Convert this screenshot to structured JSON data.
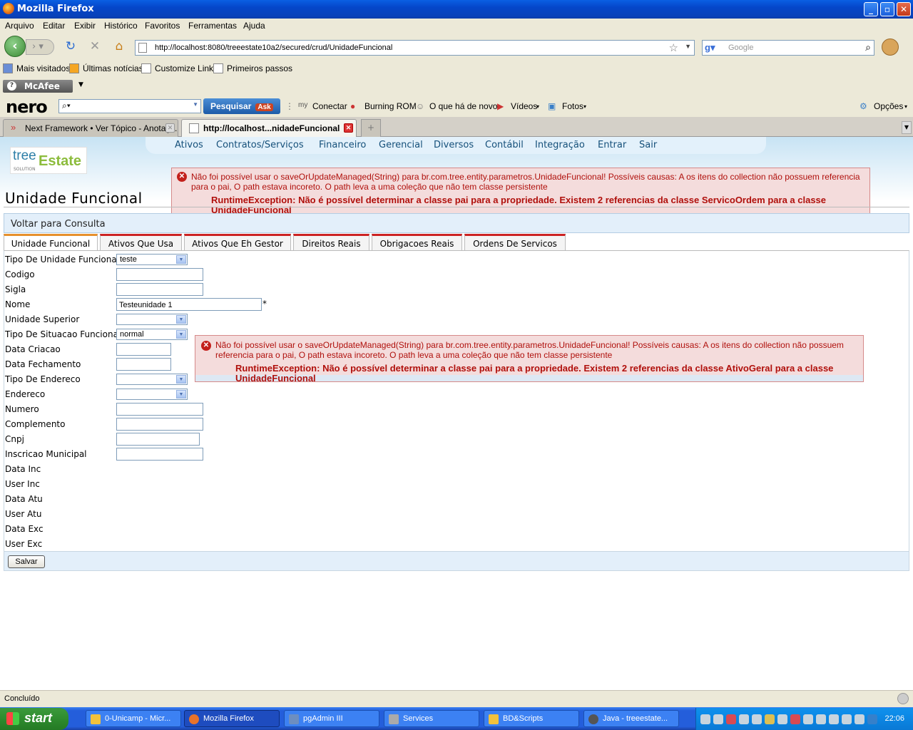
{
  "window": {
    "title": "Mozilla Firefox"
  },
  "menubar": [
    "Arquivo",
    "Editar",
    "Exibir",
    "Histórico",
    "Favoritos",
    "Ferramentas",
    "Ajuda"
  ],
  "nav": {
    "url": "http://localhost:8080/treeestate10a2/secured/crud/UnidadeFuncional",
    "search_placeholder": "Google"
  },
  "bookmarks": [
    "Mais visitados",
    "Últimas notícias",
    "Customize Links",
    "Primeiros passos"
  ],
  "mcafee": {
    "label": "McAfee"
  },
  "nero": {
    "logo": "nero",
    "search_button": "Pesquisar",
    "ask": "Ask",
    "items": [
      "Conectar",
      "Burning ROM",
      "O que há de novo",
      "Vídeos",
      "Fotos",
      "Opções"
    ]
  },
  "tabs": [
    {
      "label": "Next Framework • Ver Tópico - Anotaç..."
    },
    {
      "label": "http://localhost...nidadeFuncional"
    }
  ],
  "app": {
    "logo_text_1": "tree",
    "logo_text_2": "Estate",
    "logo_text_3": "SOLUTION",
    "menu": [
      "Ativos",
      "Contratos/Serviços",
      "Financeiro",
      "Gerencial",
      "Diversos",
      "Contábil",
      "Integração",
      "Entrar",
      "Sair"
    ],
    "page_title": "Unidade Funcional",
    "error_top": {
      "message": "Não foi possível usar o saveOrUpdateManaged(String) para br.com.tree.entity.parametros.UnidadeFuncional! Possíveis causas: A os itens do collection não possuem referencia para o pai, O path estava incoreto. O path leva a uma coleção que não tem classe persistente",
      "detail": "RuntimeException: Não é possível determinar a classe pai para a propriedade. Existem 2 referencias da classe ServicoOrdem para a classe UnidadeFuncional"
    },
    "error_mid": {
      "message": "Não foi possível usar o saveOrUpdateManaged(String) para br.com.tree.entity.parametros.UnidadeFuncional! Possíveis causas: A os itens do collection não possuem referencia para o pai, O path estava incoreto. O path leva a uma coleção que não tem classe persistente",
      "detail": "RuntimeException: Não é possível determinar a classe pai para a propriedade. Existem 2 referencias da classe AtivoGeral para a classe UnidadeFuncional"
    },
    "voltar": "Voltar para Consulta",
    "form_tabs": [
      "Unidade Funcional",
      "Ativos Que Usa",
      "Ativos Que Eh Gestor",
      "Direitos Reais",
      "Obrigacoes Reais",
      "Ordens De Servicos"
    ],
    "fields": {
      "tipo_unidade": {
        "label": "Tipo De Unidade Funcional",
        "value": "teste"
      },
      "codigo": {
        "label": "Codigo",
        "value": ""
      },
      "sigla": {
        "label": "Sigla",
        "value": ""
      },
      "nome": {
        "label": "Nome",
        "value": "Testeunidade 1"
      },
      "unidade_superior": {
        "label": "Unidade Superior",
        "value": ""
      },
      "tipo_situacao": {
        "label": "Tipo De Situacao Funcional",
        "value": "normal"
      },
      "data_criacao": {
        "label": "Data Criacao",
        "value": ""
      },
      "data_fechamento": {
        "label": "Data Fechamento",
        "value": ""
      },
      "tipo_endereco": {
        "label": "Tipo De Endereco",
        "value": ""
      },
      "endereco": {
        "label": "Endereco",
        "value": ""
      },
      "numero": {
        "label": "Numero",
        "value": ""
      },
      "complemento": {
        "label": "Complemento",
        "value": ""
      },
      "cnpj": {
        "label": "Cnpj",
        "value": ""
      },
      "inscricao": {
        "label": "Inscricao Municipal",
        "value": ""
      },
      "data_inc": {
        "label": "Data Inc"
      },
      "user_inc": {
        "label": "User Inc"
      },
      "data_atu": {
        "label": "Data Atu"
      },
      "user_atu": {
        "label": "User Atu"
      },
      "data_exc": {
        "label": "Data Exc"
      },
      "user_exc": {
        "label": "User Exc"
      }
    },
    "required_mark": "*",
    "save_label": "Salvar"
  },
  "status": "Concluído",
  "taskbar": {
    "start": "start",
    "items": [
      "0-Unicamp - Micr...",
      "Mozilla Firefox",
      "pgAdmin III",
      "Services",
      "BD&Scripts",
      "Java - treeestate..."
    ],
    "clock": "22:06"
  }
}
